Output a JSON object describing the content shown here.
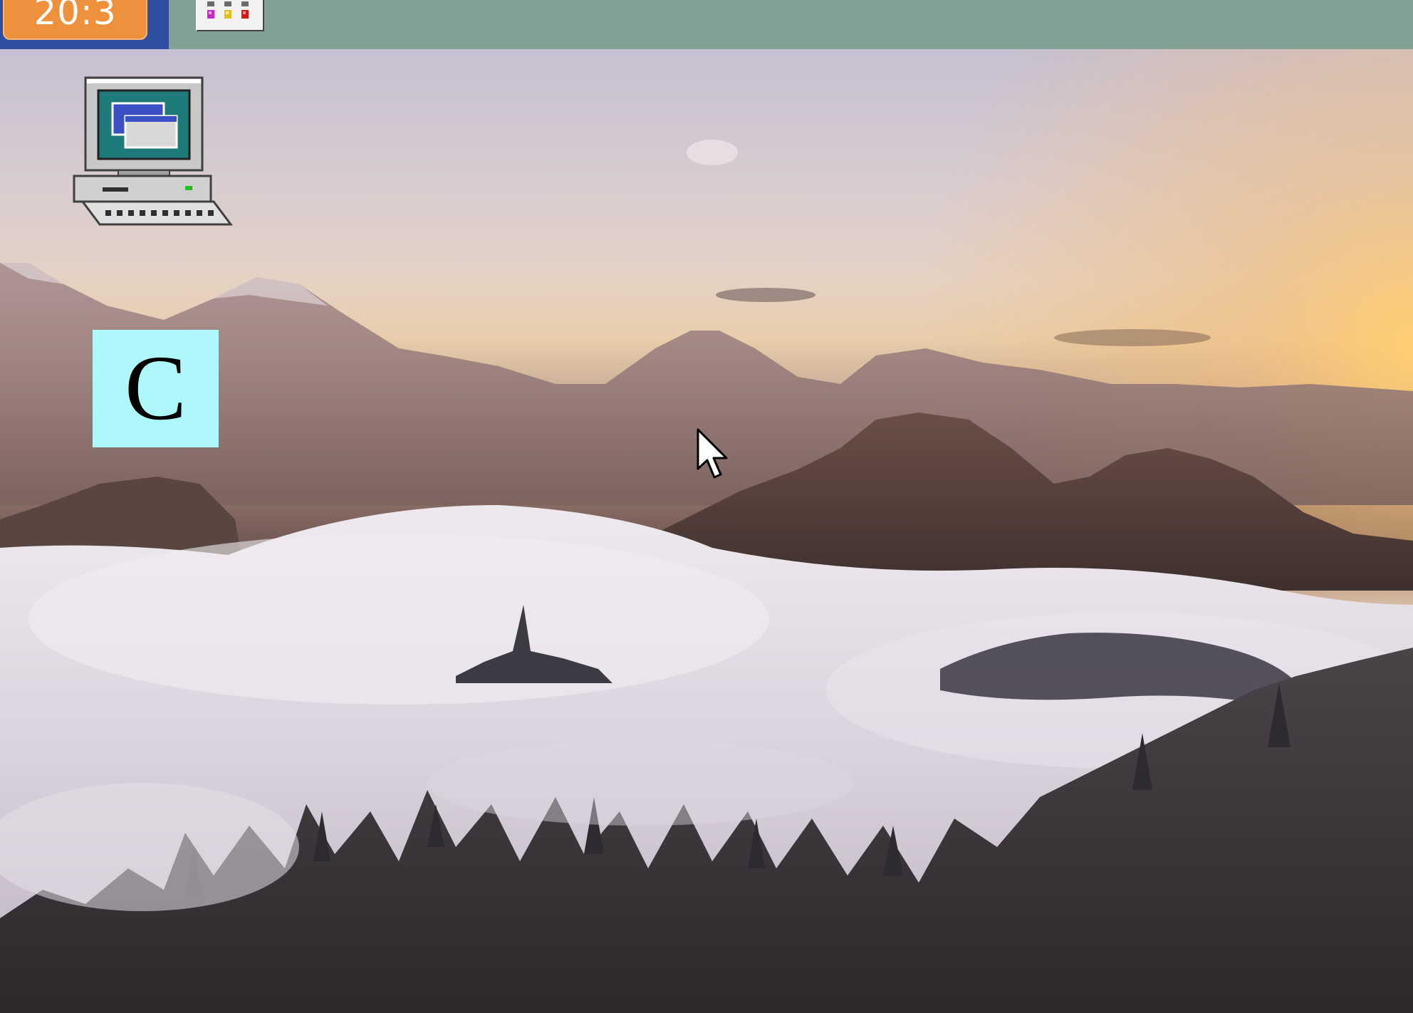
{
  "taskbar": {
    "clock_text": "20:3",
    "clock_color": "#ef913c",
    "clock_area_color": "#2e4fa0",
    "background_color": "#83a095",
    "tray_app_icon": "launcher-grid-icon"
  },
  "desktop": {
    "wallpaper": "misty-mountain-forest-sunrise",
    "icons": [
      {
        "name": "my-computer-icon"
      },
      {
        "name": "c-drive-icon",
        "letter": "C",
        "color": "#aef8fb"
      }
    ]
  },
  "cursor": {
    "icon": "arrow-cursor-icon"
  }
}
